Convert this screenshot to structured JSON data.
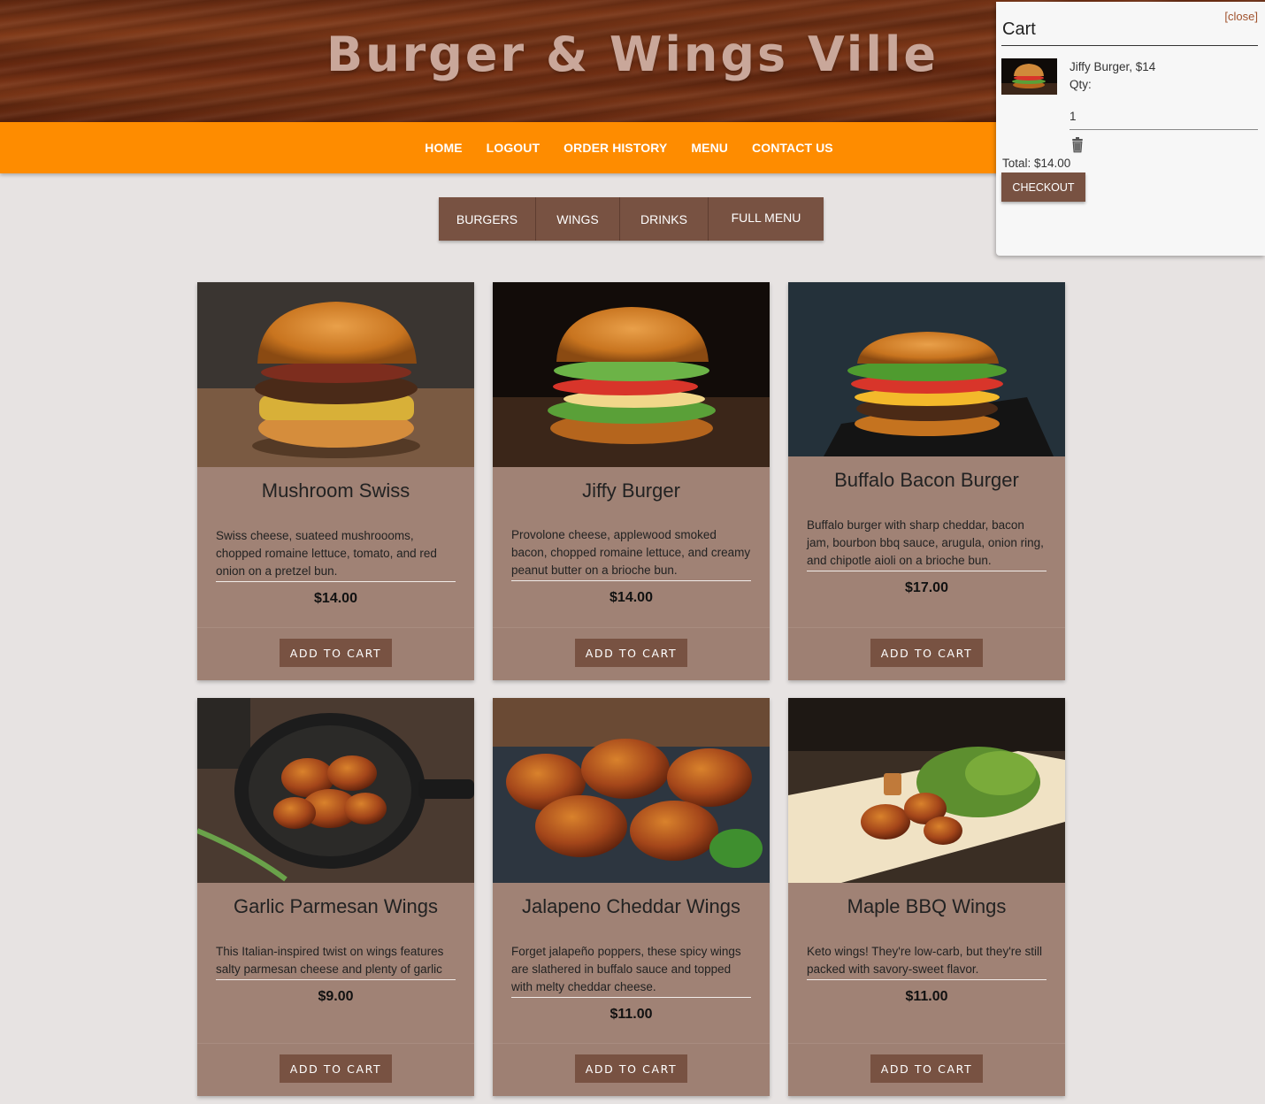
{
  "site": {
    "title": "Burger & Wings Ville"
  },
  "nav": {
    "items": [
      "HOME",
      "LOGOUT",
      "ORDER HISTORY",
      "MENU",
      "CONTACT US"
    ]
  },
  "categories": [
    "BURGERS",
    "WINGS",
    "DRINKS",
    "FULL MENU"
  ],
  "menu": {
    "add_label": "ADD TO CART",
    "items": [
      {
        "name": "Mushroom Swiss",
        "description": "Swiss cheese, suateed mushroooms, chopped romaine lettuce, tomato, and red onion on a pretzel bun.",
        "price": "$14.00",
        "image": "burger-photo"
      },
      {
        "name": "Jiffy Burger",
        "description": "Provolone cheese, applewood smoked bacon, chopped romaine lettuce, and creamy peanut butter on a brioche bun.",
        "price": "$14.00",
        "image": "burger-photo"
      },
      {
        "name": "Buffalo Bacon Burger",
        "description": "Buffalo burger with sharp cheddar, bacon jam, bourbon bbq sauce, arugula, onion ring, and chipotle aioli on a brioche bun.",
        "price": "$17.00",
        "image": "burger-photo"
      },
      {
        "name": "Garlic Parmesan Wings",
        "description": "This Italian-inspired twist on wings features salty parmesan cheese and plenty of garlic",
        "price": "$9.00",
        "image": "wings-photo"
      },
      {
        "name": "Jalapeno Cheddar Wings",
        "description": "Forget jalapeño poppers, these spicy wings are slathered in buffalo sauce and topped with melty cheddar cheese.",
        "price": "$11.00",
        "image": "wings-photo"
      },
      {
        "name": "Maple BBQ Wings",
        "description": "Keto wings! They're low-carb, but they're still packed with savory-sweet flavor.",
        "price": "$11.00",
        "image": "wings-photo"
      }
    ]
  },
  "cart": {
    "title": "Cart",
    "close_label": "[close]",
    "item_label": "Jiffy Burger, $14",
    "qty_label": "Qty:",
    "qty_value": "1",
    "total_label": "Total: $14.00",
    "checkout_label": "CHECKOUT",
    "trash_icon": "trash-icon"
  },
  "colors": {
    "brand_orange": "#fe8c00",
    "button_brown": "#785242",
    "card_bg": "#a08275",
    "page_bg": "#e7e3e2"
  }
}
